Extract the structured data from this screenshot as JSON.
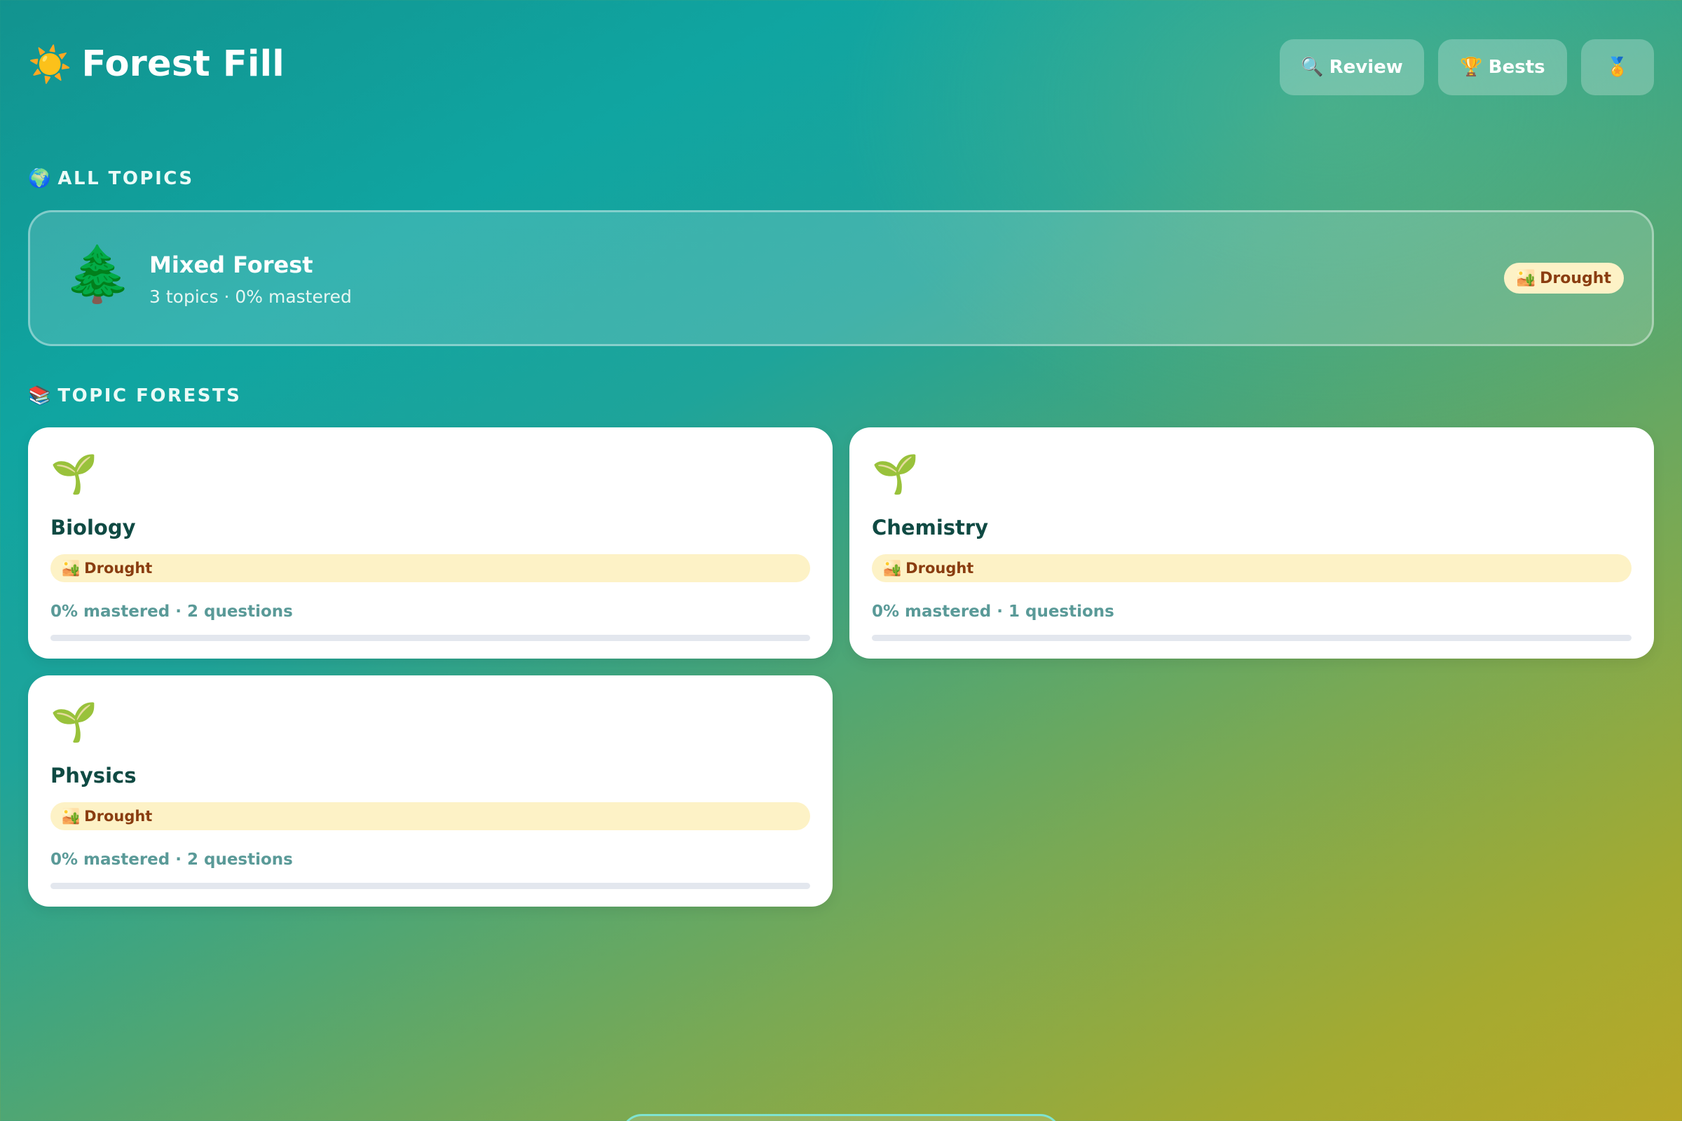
{
  "app": {
    "title": "Forest Fill",
    "logo_icon": "sun-icon"
  },
  "header": {
    "review_label": "Review",
    "review_icon": "magnifier-icon",
    "bests_label": "Bests",
    "bests_icon": "trophy-icon",
    "medal_icon": "medal-icon"
  },
  "sections": {
    "all_topics": "ALL TOPICS",
    "all_topics_icon": "globe-icon",
    "topic_forests": "TOPIC FORESTS",
    "topic_forests_icon": "books-icon"
  },
  "mixed_forest": {
    "title": "Mixed Forest",
    "subtitle": "3 topics · 0% mastered",
    "status": "Drought",
    "status_icon": "desert-icon",
    "icon": "evergreen-tree-icon"
  },
  "topics": [
    {
      "name": "Biology",
      "status": "Drought",
      "meta": "0% mastered · 2 questions",
      "progress": 0,
      "icon": "seedling-icon"
    },
    {
      "name": "Chemistry",
      "status": "Drought",
      "meta": "0% mastered · 1 questions",
      "progress": 0,
      "icon": "seedling-icon"
    },
    {
      "name": "Physics",
      "status": "Drought",
      "meta": "0% mastered · 2 questions",
      "progress": 0,
      "icon": "seedling-icon"
    }
  ],
  "colors": {
    "badge_bg": "#fdf2c6",
    "badge_text": "#8a3d10",
    "card_title": "#0f4a43",
    "card_meta": "#5a9a98",
    "progress_track": "#e3e7ee"
  }
}
